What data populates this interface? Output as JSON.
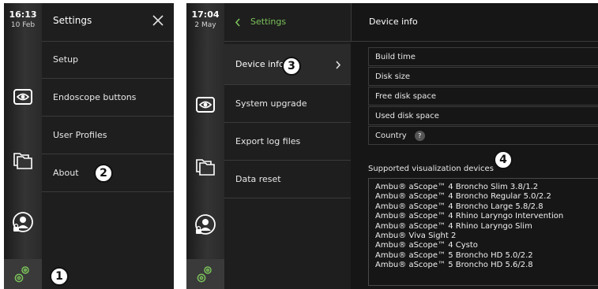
{
  "left_screen": {
    "clock": {
      "time": "16:13",
      "date": "10 Feb"
    },
    "menu": {
      "title": "Settings",
      "items": [
        {
          "label": "Setup"
        },
        {
          "label": "Endoscope buttons"
        },
        {
          "label": "User Profiles"
        },
        {
          "label": "About"
        }
      ]
    },
    "callouts": [
      "1",
      "2"
    ]
  },
  "right_screen": {
    "clock": {
      "time": "17:04",
      "date": "2 May"
    },
    "menu": {
      "back_label": "Settings",
      "items": [
        {
          "label": "Device info"
        },
        {
          "label": "System upgrade"
        },
        {
          "label": "Export log files"
        },
        {
          "label": "Data reset"
        }
      ]
    },
    "content": {
      "title": "Device info",
      "info_rows": [
        "Build time",
        "Disk size",
        "Free disk space",
        "Used disk space",
        "Country"
      ],
      "help_glyph": "?",
      "supported_title": "Supported visualization devices",
      "devices": [
        "Ambu® aScope™ 4 Broncho Slim 3.8/1.2",
        "Ambu® aScope™ 4 Broncho Regular 5.0/2.2",
        "Ambu® aScope™ 4 Broncho Large 5.8/2.8",
        "Ambu® aScope™ 4 Rhino Laryngo Intervention",
        "Ambu® aScope™ 4 Rhino Laryngo Slim",
        "Ambu® Viva Sight 2",
        "Ambu® aScope™ 4 Cysto",
        "Ambu® aScope™ 5 Broncho HD 5.0/2.2",
        "Ambu® aScope™ 5 Broncho HD 5.6/2.8"
      ]
    },
    "callouts": [
      "3",
      "4"
    ]
  },
  "icons": {
    "close": "close-icon",
    "chevron_left": "chevron-left-icon",
    "chevron_right": "chevron-right-icon",
    "eye": "eye-icon",
    "folders": "folders-icon",
    "user_lock": "user-lock-icon",
    "gear": "gear-icon",
    "help": "help-icon"
  },
  "colors": {
    "background": "#161616",
    "rail": "#343434",
    "accent_green": "#7bc25a",
    "divider": "#3a3a3a"
  }
}
